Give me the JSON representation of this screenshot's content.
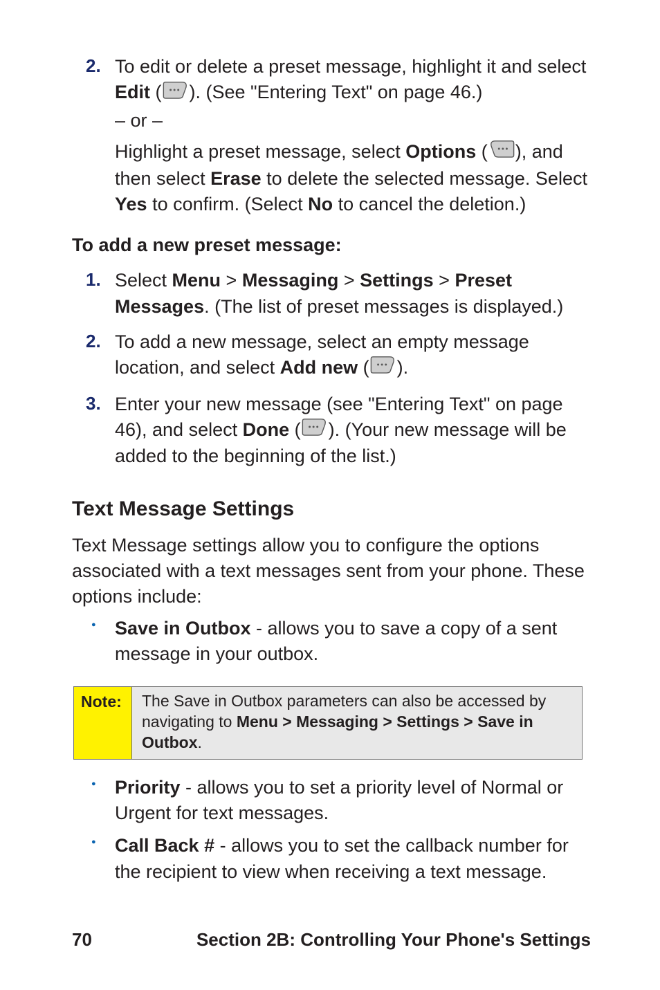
{
  "step2a": {
    "num": "2.",
    "seg1": "To edit or delete a preset message, highlight it and select ",
    "edit": "Edit",
    "seg2": " (",
    "seg3": "). (See \"Entering Text\" on page 46.)"
  },
  "or": "– or –",
  "step2b": {
    "seg1": "Highlight a preset message, select ",
    "options": "Options",
    "seg2": " (",
    "seg3": "), and then select ",
    "erase": "Erase",
    "seg4": " to delete the selected message. Select ",
    "yes": "Yes",
    "seg5": " to confirm. (Select ",
    "no": "No",
    "seg6": " to cancel the deletion.)"
  },
  "addHead": "To add a new preset message:",
  "add1": {
    "num": "1.",
    "seg1": "Select ",
    "m": "Menu",
    "s1": " > ",
    "msg": "Messaging",
    "s2": " > ",
    "set": "Settings",
    "s3": " > ",
    "pm": "Preset Messages",
    "seg2": ". (The list of preset messages is displayed.)"
  },
  "add2": {
    "num": "2.",
    "seg1": "To add a new message, select an empty message location, and select ",
    "addnew": "Add new",
    "seg2": " (",
    "seg3": ")."
  },
  "add3": {
    "num": "3.",
    "seg1": "Enter your new message (see \"Entering Text\" on page 46), and select ",
    "done": "Done",
    "seg2": " (",
    "seg3": "). (Your new message will be added to the beginning of the list.)"
  },
  "tmsHead": "Text Message Settings",
  "tmsPara": "Text Message settings allow you to configure the options associated with a text messages sent from your phone. These options include:",
  "bullets1": {
    "saveLabel": "Save in Outbox",
    "saveText": " - allows you to save a copy of a sent message in your outbox."
  },
  "note": {
    "label": "Note:",
    "seg1": "The Save in Outbox parameters can also be accessed by navigating to ",
    "path": "Menu > Messaging > Settings > Save in Outbox",
    "seg2": "."
  },
  "bullets2": {
    "prioLabel": "Priority",
    "prioText": " - allows you to set a priority level of Normal or Urgent for text messages.",
    "cbLabel": "Call Back #",
    "cbText": " - allows you to set the callback number for the recipient to view when receiving a text message."
  },
  "footer": {
    "page": "70",
    "section": "Section 2B: Controlling Your Phone's Settings"
  }
}
